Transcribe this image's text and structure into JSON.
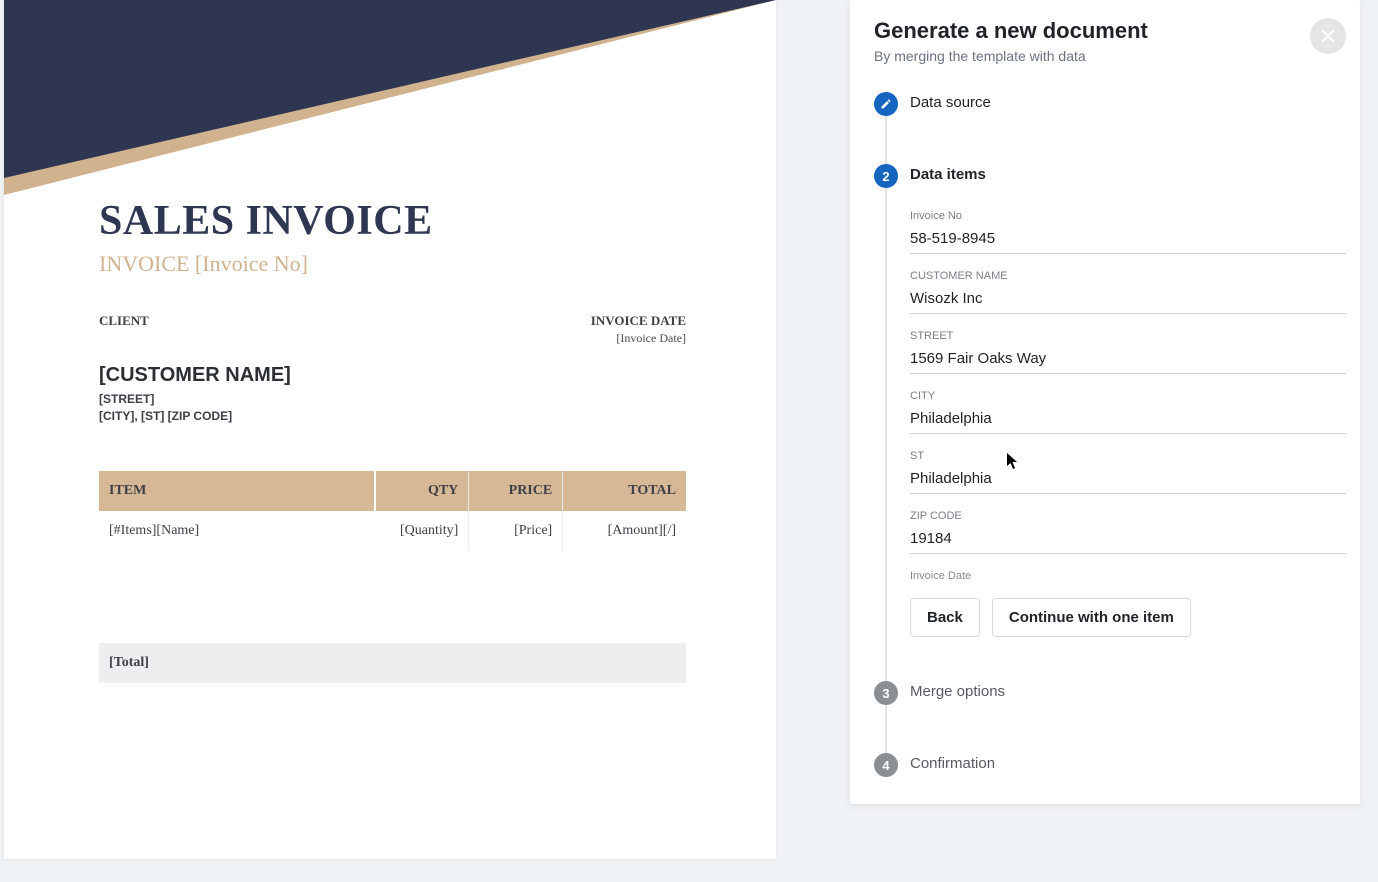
{
  "doc": {
    "title": "SALES INVOICE",
    "invoice_line": "INVOICE [Invoice No]",
    "client_label": "CLIENT",
    "invoice_date_label": "INVOICE DATE",
    "invoice_date_value": "[Invoice Date]",
    "customer_name": "[CUSTOMER NAME]",
    "street": "[STREET]",
    "city_line": "[CITY], [ST] [ZIP CODE]",
    "columns": {
      "item": "ITEM",
      "qty": "QTY",
      "price": "PRICE",
      "total": "TOTAL"
    },
    "row": {
      "name": "[#Items][Name]",
      "qty": "[Quantity]",
      "price": "[Price]",
      "amount": "[Amount][/]"
    },
    "total": "[Total]"
  },
  "panel": {
    "title": "Generate a new document",
    "subtitle": "By merging the template with data",
    "steps": {
      "s1": "Data source",
      "s2": "Data items",
      "s2_num": "2",
      "s3": "Merge options",
      "s3_num": "3",
      "s4": "Confirmation",
      "s4_num": "4"
    },
    "fields": {
      "invoice_no": {
        "label": "Invoice No",
        "value": "58-519-8945"
      },
      "customer_name": {
        "label": "CUSTOMER NAME",
        "value": "Wisozk Inc"
      },
      "street": {
        "label": "STREET",
        "value": "1569 Fair Oaks Way"
      },
      "city": {
        "label": "CITY",
        "value": "Philadelphia"
      },
      "st": {
        "label": "ST",
        "value": "Philadelphia"
      },
      "zip": {
        "label": "ZIP CODE",
        "value": "19184"
      },
      "invoice_date": {
        "label": "Invoice Date"
      }
    },
    "buttons": {
      "back": "Back",
      "continue": "Continue with one item"
    }
  }
}
